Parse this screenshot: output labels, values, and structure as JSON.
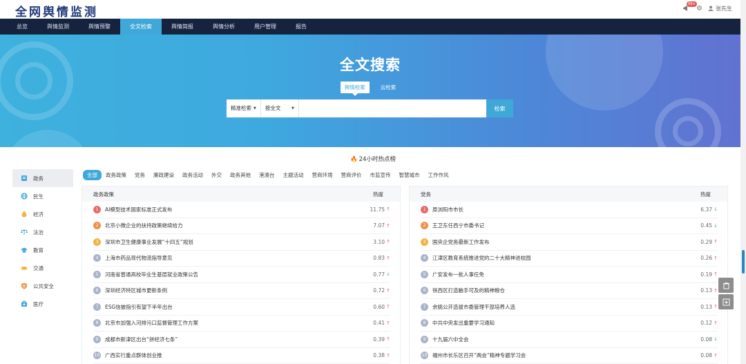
{
  "brand": "全网舆情监测",
  "header": {
    "badge": "99+",
    "user": "张先生"
  },
  "nav": [
    "总览",
    "舆情监测",
    "舆情预警",
    "全文检索",
    "舆情简报",
    "舆情分析",
    "用户管理",
    "报告"
  ],
  "hero": {
    "title": "全文搜索",
    "tabs": [
      "舆情检索",
      "云检索"
    ],
    "select1": "精准检索",
    "select2": "按全文",
    "search_button": "检索",
    "search_value": ""
  },
  "hot_heading": "24小时热点榜",
  "sidebar": [
    "政务",
    "民生",
    "经济",
    "法治",
    "教育",
    "交通",
    "公共安全",
    "医疗"
  ],
  "categories": [
    "全部",
    "政务政策",
    "党务",
    "廉政建设",
    "政务活动",
    "外交",
    "政务其他",
    "港澳台",
    "主题活动",
    "营商环境",
    "营商评价",
    "市监宣传",
    "智慧城市",
    "工作作风"
  ],
  "panels": [
    {
      "name": "政务政策",
      "heat_label": "热度",
      "rows": [
        {
          "rank": "1",
          "title": "AI模型技术国家标准正式发布",
          "heat": "11.75",
          "dir": "up"
        },
        {
          "rank": "2",
          "title": "北京小微企业的扶持政策继续给力",
          "heat": "7.07",
          "dir": "up"
        },
        {
          "rank": "3",
          "title": "深圳市卫生健康事业发展“十四五”规划",
          "heat": "3.10",
          "dir": "up"
        },
        {
          "rank": "4",
          "title": "上海市药品现代物流指导意见",
          "heat": "0.83",
          "dir": "up"
        },
        {
          "rank": "5",
          "title": "河南省普通高校毕业生基层就业政策公告",
          "heat": "0.77",
          "dir": "down"
        },
        {
          "rank": "6",
          "title": "深圳经济特区城市更新条例",
          "heat": "0.72",
          "dir": "up"
        },
        {
          "rank": "7",
          "title": "ESG信披指引有望下半年出台",
          "heat": "0.60",
          "dir": "up"
        },
        {
          "rank": "8",
          "title": "北京市加强入河排污口监督管理工作方案",
          "heat": "0.41",
          "dir": "up"
        },
        {
          "rank": "9",
          "title": "成都市新津区出台“拼经济七条”",
          "heat": "0.39",
          "dir": "up"
        },
        {
          "rank": "10",
          "title": "广西实行重点群体创业推",
          "heat": "0.38",
          "dir": "up"
        }
      ]
    },
    {
      "name": "党务",
      "heat_label": "热度",
      "rows": [
        {
          "rank": "1",
          "title": "原浏阳市市长",
          "heat": "6.37",
          "dir": "down"
        },
        {
          "rank": "2",
          "title": "王卫东任西宁市委书记",
          "heat": "0.45",
          "dir": "down"
        },
        {
          "rank": "3",
          "title": "国央企党务最新工作发布",
          "heat": "0.29",
          "dir": "up"
        },
        {
          "rank": "4",
          "title": "江津区教育系统推进党的二十大精神进校园",
          "heat": "0.26",
          "dir": "up"
        },
        {
          "rank": "5",
          "title": "广安发布一批人事任免",
          "heat": "0.19",
          "dir": "up"
        },
        {
          "rank": "6",
          "title": "铁西区打造触手可及的精神粮仓",
          "heat": "0.13",
          "dir": "up"
        },
        {
          "rank": "7",
          "title": "余姚公开选拔市委管理干部培养人选",
          "heat": "0.13",
          "dir": "up"
        },
        {
          "rank": "8",
          "title": "中共中央发出重要学习通知",
          "heat": "0.12",
          "dir": "up"
        },
        {
          "rank": "9",
          "title": "十九届六中全会",
          "heat": "0.08",
          "dir": "down"
        },
        {
          "rank": "10",
          "title": "福州市长乐区召开“两会”精神专题学习会",
          "heat": "0.08",
          "dir": "up"
        }
      ]
    }
  ],
  "colors": {
    "accent": "#3fa8d8",
    "nav_bg": "#16233f",
    "rank1": "#e86a6a",
    "rank2": "#ef9148",
    "rank3": "#f2b443",
    "rank_other": "#aab4c8"
  }
}
